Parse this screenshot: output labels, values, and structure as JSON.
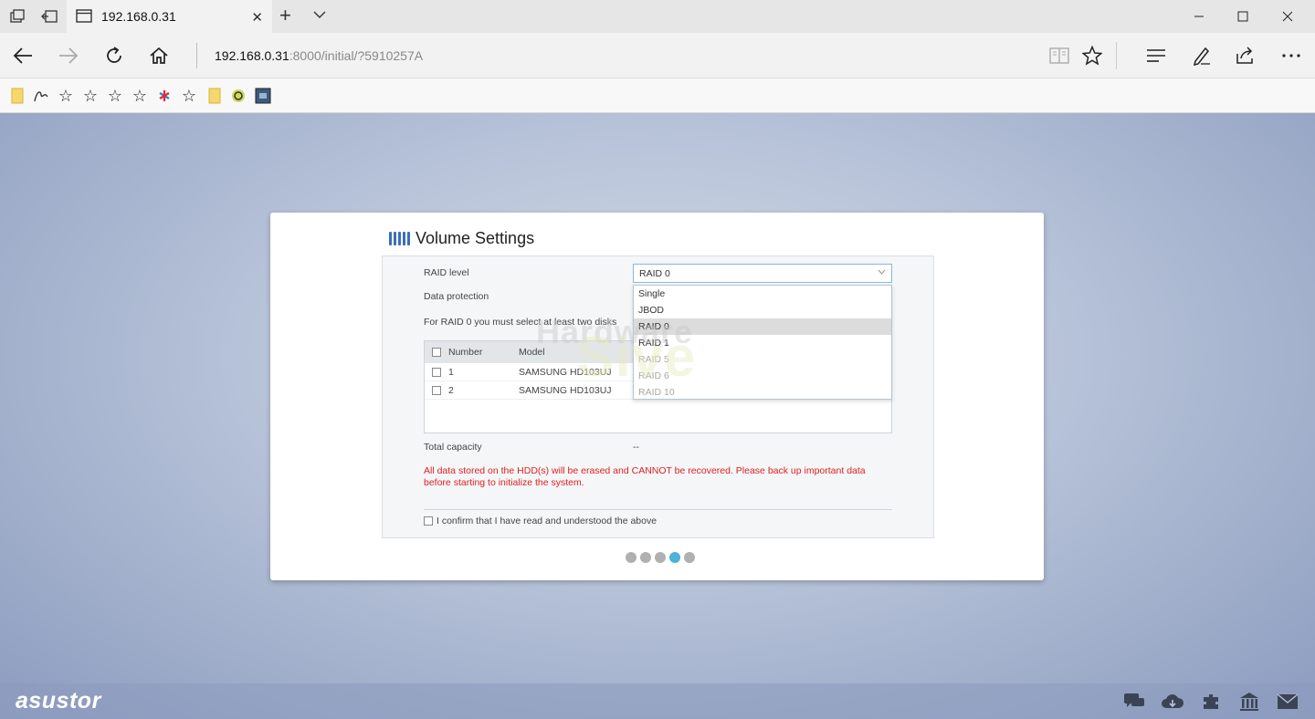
{
  "browser": {
    "tab_title": "192.168.0.31",
    "tab_close": "✕",
    "new_tab": "+",
    "url_host": "192.168.0.31",
    "url_rest": ":8000/initial/?5910257A"
  },
  "volume_settings": {
    "title": "Volume Settings",
    "raid_level_label": "RAID level",
    "raid_level_value": "RAID 0",
    "raid_options": [
      {
        "label": "Single",
        "state": "normal"
      },
      {
        "label": "JBOD",
        "state": "normal"
      },
      {
        "label": "RAID 0",
        "state": "selected"
      },
      {
        "label": "RAID 1",
        "state": "normal"
      },
      {
        "label": "RAID 5",
        "state": "faded"
      },
      {
        "label": "RAID 6",
        "state": "faded"
      },
      {
        "label": "RAID 10",
        "state": "faded"
      }
    ],
    "data_protection_label": "Data protection",
    "disk_hint": "For RAID 0 you must select at least two disks",
    "table": {
      "columns": [
        "Number",
        "Model"
      ],
      "rows": [
        {
          "number": "1",
          "model": "SAMSUNG HD103UJ"
        },
        {
          "number": "2",
          "model": "SAMSUNG HD103UJ"
        }
      ]
    },
    "total_capacity_label": "Total capacity",
    "total_capacity_value": "--",
    "warning": "All data stored on the HDD(s) will be erased and CANNOT be recovered. Please back up important data before starting to initialize the system.",
    "confirm_label": "I confirm that I have read and understood the above",
    "steps_total": 5,
    "steps_active": 4
  },
  "watermark": {
    "line1": "Hardware",
    "line2": "Sive"
  },
  "footer": {
    "logo": "asustor"
  },
  "colors": {
    "accent": "#4ab3d6",
    "warning": "#e02020",
    "icon_blue": "#3a6fb7"
  }
}
